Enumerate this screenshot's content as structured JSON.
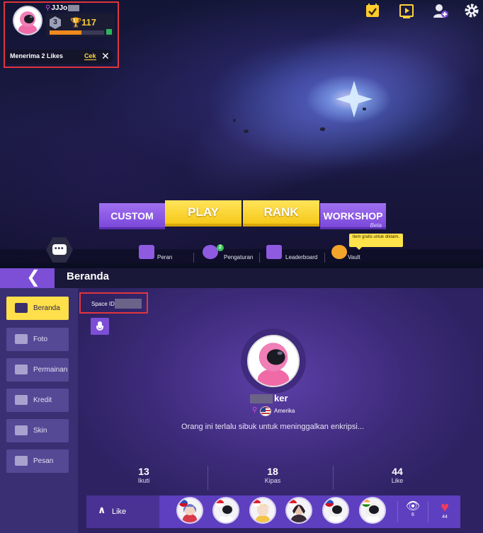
{
  "profile": {
    "name_prefix": "JJJo",
    "level": "3",
    "trophies": "117",
    "xp_progress": 0.58,
    "notification": "Menerima 2 Likes",
    "notification_action": "Cek",
    "close_glyph": "✕"
  },
  "top_icons": [
    "checklist-icon",
    "video-icon",
    "add-friend-icon",
    "settings-icon"
  ],
  "modes": {
    "custom": "CUSTOM",
    "play": "PLAY",
    "rank": "RANK",
    "workshop": "WORKSHOP",
    "workshop_tag": "Beta"
  },
  "nav": {
    "items": [
      {
        "label": "Peran",
        "icon": "role-icon"
      },
      {
        "label": "Pengaturan",
        "icon": "friends-icon",
        "badge": "2"
      },
      {
        "label": "Leaderboard",
        "icon": "leaderboard-icon"
      },
      {
        "label": "Vault",
        "icon": "vault-icon"
      }
    ],
    "tooltip": "Item gratis untuk diklaim."
  },
  "page": {
    "back_glyph": "❮",
    "title": "Beranda"
  },
  "sidebar": {
    "items": [
      {
        "label": "Beranda",
        "active": true
      },
      {
        "label": "Foto"
      },
      {
        "label": "Permainan"
      },
      {
        "label": "Kredit"
      },
      {
        "label": "Skin"
      },
      {
        "label": "Pesan"
      }
    ]
  },
  "profile_detail": {
    "space_id_label": "Space ID",
    "username_suffix": "ker",
    "country": "Amerika",
    "bio": "Orang ini terlalu sibuk untuk meninggalkan enkripsi...",
    "stats": [
      {
        "value": "13",
        "label": "Ikuti"
      },
      {
        "value": "18",
        "label": "Kipas"
      },
      {
        "value": "44",
        "label": "Like"
      }
    ]
  },
  "like_bar": {
    "label": "Like",
    "chevron": "∧",
    "views": "6",
    "likes": "44"
  },
  "colors": {
    "accent_purple": "#7c4fd6",
    "accent_yellow": "#ffe04a",
    "highlight_red": "#e0353d",
    "heart_red": "#f23b5b"
  }
}
